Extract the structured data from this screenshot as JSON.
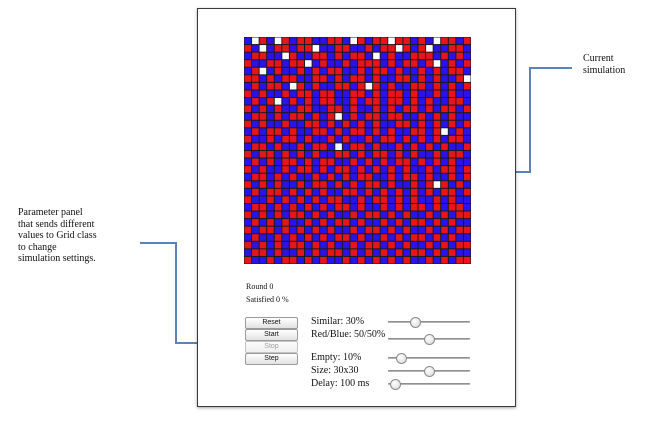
{
  "annotations": {
    "current_simulation": [
      "Current",
      "simulation"
    ],
    "parameter_panel": [
      "Parameter panel",
      "that sends different",
      "values to Grid class",
      "to change",
      "simulation settings."
    ]
  },
  "status": {
    "round": "Round 0",
    "satisfied": "Satisfied 0 %"
  },
  "buttons": {
    "reset": "Reset",
    "start": "Start",
    "stop": "Stop",
    "step": "Step"
  },
  "parameters": {
    "similar": {
      "label": "Similar: 30%",
      "value": 0.3
    },
    "red_blue": {
      "label": "Red/Blue: 50/50%",
      "value": 0.5
    },
    "empty": {
      "label": "Empty: 10%",
      "value": 0.1
    },
    "size": {
      "label": "Size: 30x30",
      "value": 0.5
    },
    "delay": {
      "label": "Delay: 100 ms",
      "value": 0.02
    }
  },
  "grid": {
    "rows": 30,
    "cols": 30,
    "legend": {
      "R": "red agent",
      "B": "blue agent",
      "W": "empty cell"
    },
    "colors": {
      "R": "#e8141b",
      "B": "#2a12e8",
      "W": "#ffffff",
      "line": "#1a1a1a"
    },
    "cells": [
      "BWRBWRBRRBBRRBWRBRRWRRBRBWRRBR",
      "RBWBRRBRRWBBRRBBRBRRWRBRWBBRRB",
      "BRRBBWRBBRRBRBRRBWBRBBRRRBRBRB",
      "RBBRRBRRWBRBBRBRRRBRBRRBRWBRBR",
      "BRWBRBBRBRBRRBBRBRRBRBBRBRBRRB",
      "RRBRBRRBBRRBRBRRBRBBRRBRBRBBRW",
      "BRBRRBWRBRBBRRBRWRBRBBRRBRBRBR",
      "RBRBBRBRRBRRBBRRBRBRRBRBBRBRBB",
      "BRBRWBRBRBRRBBRBRRBRRBRBRBBRRB",
      "RBRBRBBRRBBRRBRBBRBRBRRBRBRRBR",
      "BRRBRBRRBRBRWBRBRRBRRBBRBRBRBB",
      "RBRBBRBBRRBRBRBRBRBBRRBRBRBRBR",
      "BRBRRBRBBRRBRBRRBRBRBBRRBRWBRB",
      "RBBRBRRBRBBRBRBBRBRRBRBRBRBRRB",
      "BRRBRBBRBRRBWBRRBRBBRBRBRBRBBR",
      "RBRRBRBRBRBBRRBRBRRBRBRBBRBRRB",
      "BRBRBRRBRBRRBBRBRBRBRRBRBRBRBB",
      "RBRBBRBRRBRBRRBRBRBRBRBBRBRRBR",
      "BRRBRBRBBRBRBRBRRBBRBRRBRBBRBR",
      "RBRBRBBRBRRBRBRBRRBRBBRBRWRBRB",
      "BRBRRBRBRBRBBRRBRBRBRBRBRBRRBR",
      "RBBRBRBRBRBRRBBRBRRBRBRBBRBRBB",
      "BRRBRBRBRBRBRRBRBBRBRBRRBRBRRB",
      "RBRBRBRRBRBRBBRBRRBRBRBBRBRBRR",
      "BRBRBRBBRBRBRRBRBBRBRBRRBRBRBB",
      "RBRRBRBRBRBRBBRBRRBRBRBBRBRBRR",
      "BRBBRBRBRBRBRRBRBBRBRBRRBRBRBB",
      "RBRBRBRRBRBRBBRBRRBRBRBBRBRBRR",
      "BRRBRBBRBRBRRBRBRBRBRBRRBRBRBB",
      "RBBRBRRBRBRBBRBRBRBRBRBBRBRBRR"
    ]
  }
}
